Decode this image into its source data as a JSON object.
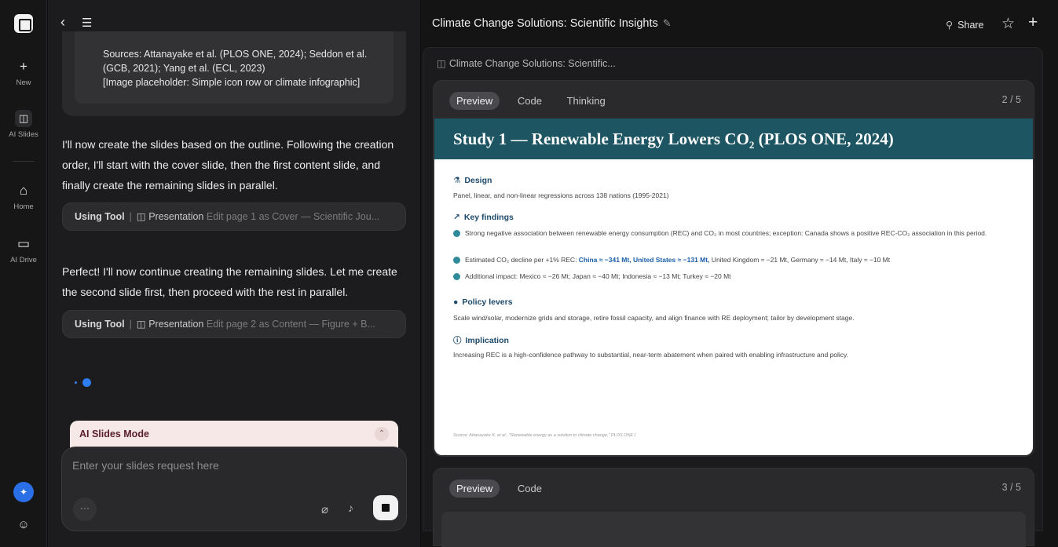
{
  "rail": {
    "new_label": "New",
    "ai_slides_label": "AI Slides",
    "home_label": "Home",
    "ai_drive_label": "AI Drive"
  },
  "chat": {
    "sources": {
      "line1": "Sources: Attanayake et al. (PLOS ONE, 2024); Seddon et al.",
      "line2": "(GCB, 2021); Yang et al. (ECL, 2023)",
      "line3": "[Image placeholder: Simple icon row or climate infographic]"
    },
    "message1": "I'll now create the slides based on the outline. Following the creation order, I'll start with the cover slide, then the first content slide, and finally create the remaining slides in parallel.",
    "tool1": {
      "using": "Using Tool",
      "name": "Presentation",
      "detail": "Edit page 1 as Cover — Scientific Jou..."
    },
    "message2": "Perfect! I'll now continue creating the remaining slides. Let me create the second slide first, then proceed with the rest in parallel.",
    "tool2": {
      "using": "Using Tool",
      "name": "Presentation",
      "detail": "Edit page 2 as Content — Figure + B..."
    },
    "mode_title": "AI Slides Mode",
    "composer_placeholder": "Enter your slides request here",
    "more_label": "···"
  },
  "panel": {
    "title": "Climate Change Solutions: Scientific Insights",
    "share_label": "Share",
    "breadcrumb": "Climate Change Solutions: Scientific...",
    "card1": {
      "tabs": [
        "Preview",
        "Code",
        "Thinking"
      ],
      "counter": "2 / 5"
    },
    "card2": {
      "tabs": [
        "Preview",
        "Code"
      ],
      "counter": "3 / 5"
    }
  },
  "slide": {
    "title": "Study 1 — Renewable Energy Lowers CO",
    "title_sub": "2",
    "title_suffix": " (PLOS ONE, 2024)",
    "design_heading": "Design",
    "design_text": "Panel, linear, and non-linear regressions across 138 nations (1995-2021)",
    "findings_heading": "Key findings",
    "finding1": "Strong negative association between renewable energy consumption (REC) and CO₂ in most countries; exception: Canada shows a positive REC-CO₂ association in this period.",
    "finding2_prefix": "Estimated CO₂ decline per +1% REC: ",
    "finding2_highlight": "China ≈ −341 Mt, United States ≈ −131 Mt,",
    "finding2_rest": " United Kingdom ≈ −21 Mt, Germany ≈ −14 Mt, Italy ≈ −10 Mt",
    "finding3": "Additional impact: Mexico ≈ −26 Mt; Japan ≈ −40 Mt; Indonesia ≈ −13 Mt; Turkey ≈ −20 Mt",
    "policy_heading": "Policy levers",
    "policy_text": "Scale wind/solar, modernize grids and storage, retire fossil capacity, and align finance with RE deployment; tailor by development stage.",
    "implication_heading": "Implication",
    "implication_text": "Increasing REC is a high-confidence pathway to substantial, near-term abatement when paired with enabling infrastructure and policy.",
    "source_note": "Source: Attanayake K. et al., \"Renewable energy as a solution to climate change,\" PLOS ONE (",
    "accent_color": "#1d5563"
  }
}
